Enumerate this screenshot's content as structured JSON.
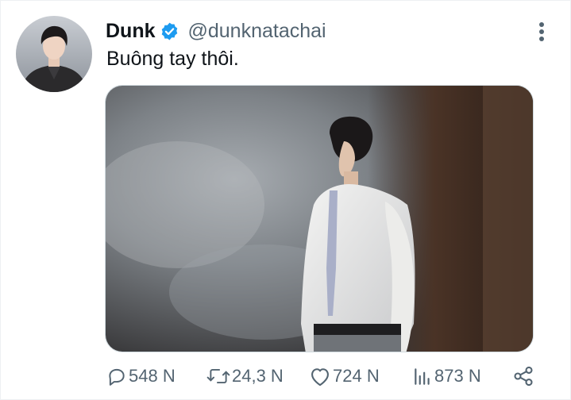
{
  "author": {
    "display_name": "Dunk",
    "handle": "@dunknatachai",
    "verified_color": "#1d9bf0",
    "avatar_icon": "profile-photo"
  },
  "tweet": {
    "text": "Buông tay thôi.",
    "media_description_icon": "tweet-photo"
  },
  "actions": {
    "reply_count": "548 N",
    "retweet_count": "24,3 N",
    "like_count": "724 N",
    "views_count": "873 N"
  },
  "colors": {
    "text_primary": "#0f1419",
    "text_secondary": "#536471",
    "accent": "#1d9bf0"
  }
}
